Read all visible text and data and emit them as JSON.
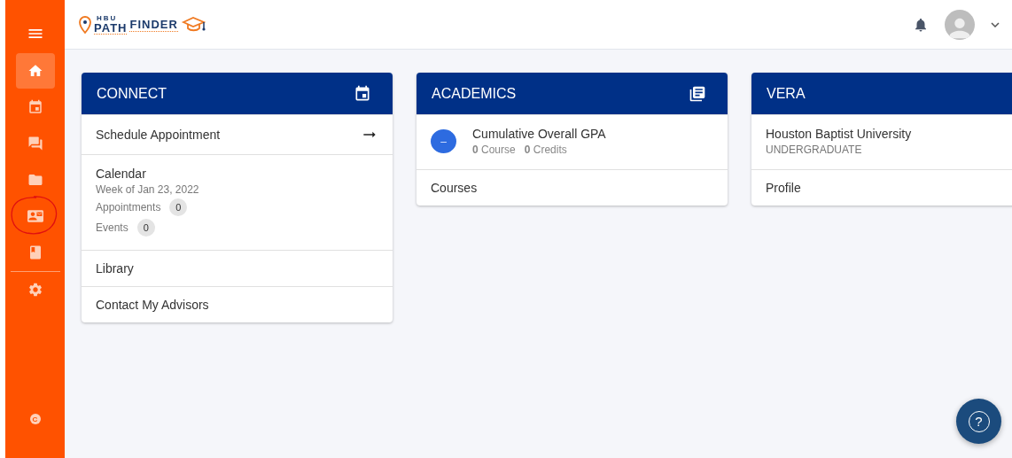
{
  "sidebar": {
    "items": [
      {
        "kind": "home",
        "selected": true,
        "circled": false
      },
      {
        "kind": "calendar",
        "selected": false,
        "circled": false
      },
      {
        "kind": "chat",
        "selected": false,
        "circled": false
      },
      {
        "kind": "folder",
        "selected": false,
        "circled": false
      },
      {
        "kind": "contacts",
        "selected": false,
        "circled": true
      },
      {
        "kind": "book",
        "selected": false,
        "circled": false
      },
      {
        "kind": "divider"
      },
      {
        "kind": "settings",
        "selected": false,
        "circled": false
      }
    ],
    "footer_logo": "C"
  },
  "header": {
    "logo": {
      "small": "HBU",
      "left": "PATH",
      "right": "FINDER"
    }
  },
  "cards": [
    {
      "title": "CONNECT",
      "rows": [
        {
          "kind": "link",
          "label": "Schedule Appointment",
          "arrow": true
        },
        {
          "kind": "calendar",
          "label": "Calendar",
          "subtitle": "Week of Jan 23, 2022",
          "counts": [
            {
              "label": "Appointments",
              "value": "0"
            },
            {
              "label": "Events",
              "value": "0"
            }
          ]
        },
        {
          "kind": "link",
          "label": "Library",
          "arrow": false
        },
        {
          "kind": "link",
          "label": "Contact My Advisors",
          "arrow": false
        }
      ]
    },
    {
      "title": "ACADEMICS",
      "rows": [
        {
          "kind": "gpa",
          "badge": "–",
          "label": "Cumulative Overall GPA",
          "stats": [
            "**0** Course",
            "**0** Credits"
          ]
        },
        {
          "kind": "link",
          "label": "Courses",
          "arrow": false
        }
      ]
    },
    {
      "title": "VERA",
      "rows": [
        {
          "kind": "school",
          "label": "Houston Baptist University",
          "subtitle": "UNDERGRADUATE"
        },
        {
          "kind": "link",
          "label": "Profile",
          "arrow": false
        }
      ]
    }
  ],
  "help_button": "?"
}
